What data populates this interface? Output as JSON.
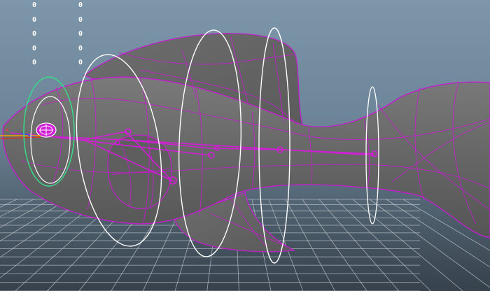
{
  "viewport": {
    "name": "3D viewport - fish rig",
    "background_top": "#7d96aa",
    "background_bottom": "#36414b",
    "grid_color": "#c8cdd2",
    "mesh_color": "#6a6a6a",
    "wireframe_color": "#d11fd6",
    "control_curve_color": "#ffffff",
    "head_control_color": "#39d98a",
    "hud": {
      "column_1": [
        "0",
        "0",
        "0",
        "0",
        "0"
      ],
      "column_2": [
        "0",
        "0",
        "0",
        "0",
        "0"
      ]
    }
  }
}
